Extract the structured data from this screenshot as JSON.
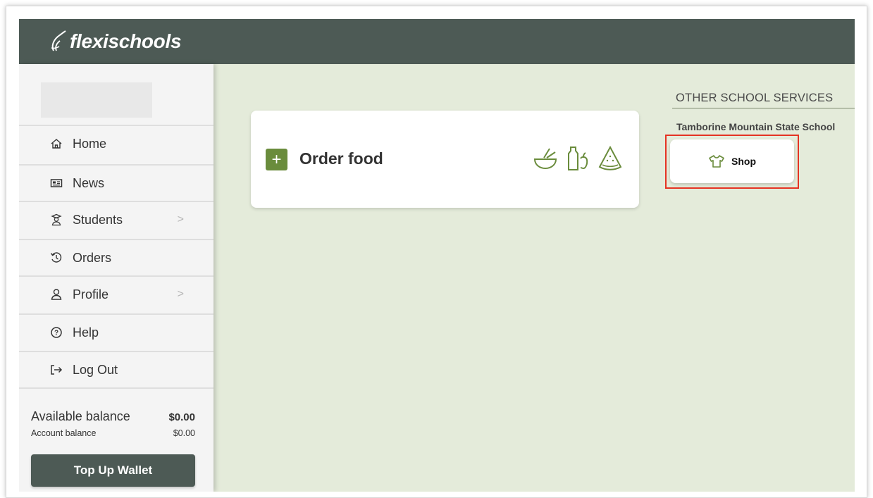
{
  "header": {
    "brand": "flexischools"
  },
  "sidebar": {
    "items": [
      {
        "label": "Home",
        "icon": "home-icon"
      },
      {
        "label": "News",
        "icon": "newspaper-icon"
      },
      {
        "label": "Students",
        "icon": "student-icon",
        "has_submenu": true
      },
      {
        "label": "Orders",
        "icon": "history-icon"
      },
      {
        "label": "Profile",
        "icon": "user-icon",
        "has_submenu": true
      },
      {
        "label": "Help",
        "icon": "help-icon"
      },
      {
        "label": "Log Out",
        "icon": "logout-icon"
      }
    ],
    "balance": {
      "available_label": "Available balance",
      "available_value": "$0.00",
      "account_label": "Account balance",
      "account_value": "$0.00"
    },
    "topup_label": "Top Up Wallet"
  },
  "main": {
    "order_card": {
      "label": "Order food"
    },
    "other_services": {
      "title": "OTHER SCHOOL SERVICES",
      "school": "Tamborine Mountain State School",
      "shop_label": "Shop"
    }
  },
  "colors": {
    "header_bg": "#4d5a55",
    "content_bg": "#e4ebda",
    "accent_green": "#6a8c3c",
    "highlight_red": "#e53323"
  }
}
